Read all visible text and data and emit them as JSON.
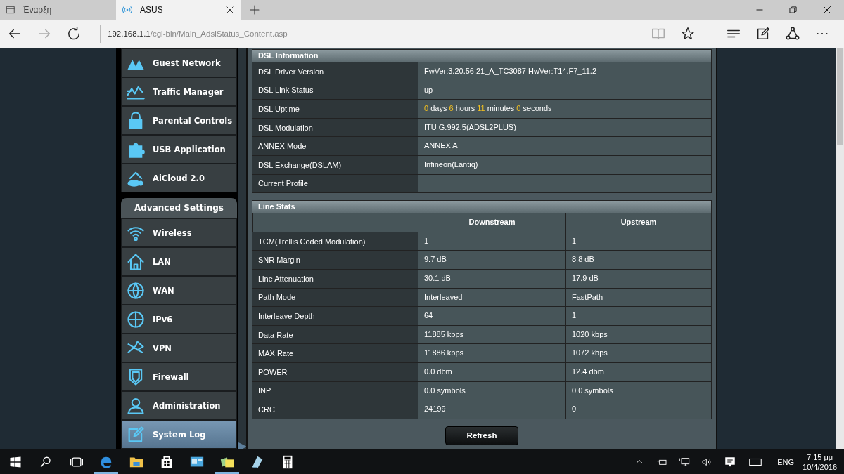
{
  "browser": {
    "tabs": [
      {
        "title": "Έναρξη",
        "selected": false
      },
      {
        "title": "ASUS",
        "selected": true
      }
    ],
    "address": {
      "host": "192.168.1.1",
      "path": "/cgi-bin/Main_AdslStatus_Content.asp"
    }
  },
  "sidebar": {
    "top_items": [
      {
        "label": "Guest Network",
        "selected": false
      },
      {
        "label": "Traffic Manager",
        "selected": false
      },
      {
        "label": "Parental Controls",
        "selected": false
      },
      {
        "label": "USB Application",
        "selected": false
      },
      {
        "label": "AiCloud 2.0",
        "selected": false
      }
    ],
    "advanced_title": "Advanced Settings",
    "advanced_items": [
      {
        "label": "Wireless",
        "selected": false
      },
      {
        "label": "LAN",
        "selected": false
      },
      {
        "label": "WAN",
        "selected": false
      },
      {
        "label": "IPv6",
        "selected": false
      },
      {
        "label": "VPN",
        "selected": false
      },
      {
        "label": "Firewall",
        "selected": false
      },
      {
        "label": "Administration",
        "selected": false
      },
      {
        "label": "System Log",
        "selected": true
      }
    ]
  },
  "dsl_information": {
    "title": "DSL Information",
    "rows": [
      {
        "label": "DSL Driver Version",
        "value": [
          {
            "text": "FwVer:3.20.56.21_A_TC3087 HwVer:T14.F7_11.2",
            "kind": "plain"
          }
        ]
      },
      {
        "label": "DSL Link Status",
        "value": [
          {
            "text": "up",
            "kind": "plain"
          }
        ]
      },
      {
        "label": "DSL Uptime",
        "value": [
          {
            "text": "0",
            "kind": "number"
          },
          {
            "text": "days",
            "kind": "plain"
          },
          {
            "text": "6",
            "kind": "number"
          },
          {
            "text": "hours",
            "kind": "plain"
          },
          {
            "text": "11",
            "kind": "number"
          },
          {
            "text": "minutes",
            "kind": "plain"
          },
          {
            "text": "0",
            "kind": "number"
          },
          {
            "text": "seconds",
            "kind": "plain"
          }
        ]
      },
      {
        "label": "DSL Modulation",
        "value": [
          {
            "text": "ITU G.992.5(ADSL2PLUS)",
            "kind": "plain"
          }
        ]
      },
      {
        "label": "ANNEX Mode",
        "value": [
          {
            "text": "ANNEX A",
            "kind": "plain"
          }
        ]
      },
      {
        "label": "DSL Exchange(DSLAM)",
        "value": [
          {
            "text": "Infineon(Lantiq)",
            "kind": "plain"
          }
        ]
      },
      {
        "label": "Current Profile",
        "value": []
      }
    ]
  },
  "line_stats": {
    "title": "Line Stats",
    "columns": [
      "Downstream",
      "Upstream"
    ],
    "rows": [
      {
        "label": "TCM(Trellis Coded Modulation)",
        "cells": [
          "1",
          "1"
        ]
      },
      {
        "label": "SNR Margin",
        "cells": [
          "9.7 dB",
          "8.8 dB"
        ]
      },
      {
        "label": "Line Attenuation",
        "cells": [
          "30.1 dB",
          "17.9 dB"
        ]
      },
      {
        "label": "Path Mode",
        "cells": [
          "Interleaved",
          "FastPath"
        ]
      },
      {
        "label": "Interleave Depth",
        "cells": [
          "64",
          "1"
        ]
      },
      {
        "label": "Data Rate",
        "cells": [
          "11885 kbps",
          "1020 kbps"
        ]
      },
      {
        "label": "MAX Rate",
        "cells": [
          "11886 kbps",
          "1072 kbps"
        ]
      },
      {
        "label": "POWER",
        "cells": [
          "0.0 dbm",
          "12.4 dbm"
        ]
      },
      {
        "label": "INP",
        "cells": [
          "0.0 symbols",
          "0.0 symbols"
        ]
      },
      {
        "label": "CRC",
        "cells": [
          "24199",
          "0"
        ]
      }
    ]
  },
  "refresh_button": "Refresh",
  "taskbar": {
    "apps": [
      {
        "running": true
      },
      {
        "running": false
      },
      {
        "running": false
      },
      {
        "running": false
      },
      {
        "running": true
      },
      {
        "running": false
      },
      {
        "running": false
      }
    ],
    "language": "ENG",
    "time": "7:15 μμ",
    "date": "10/4/2016"
  }
}
